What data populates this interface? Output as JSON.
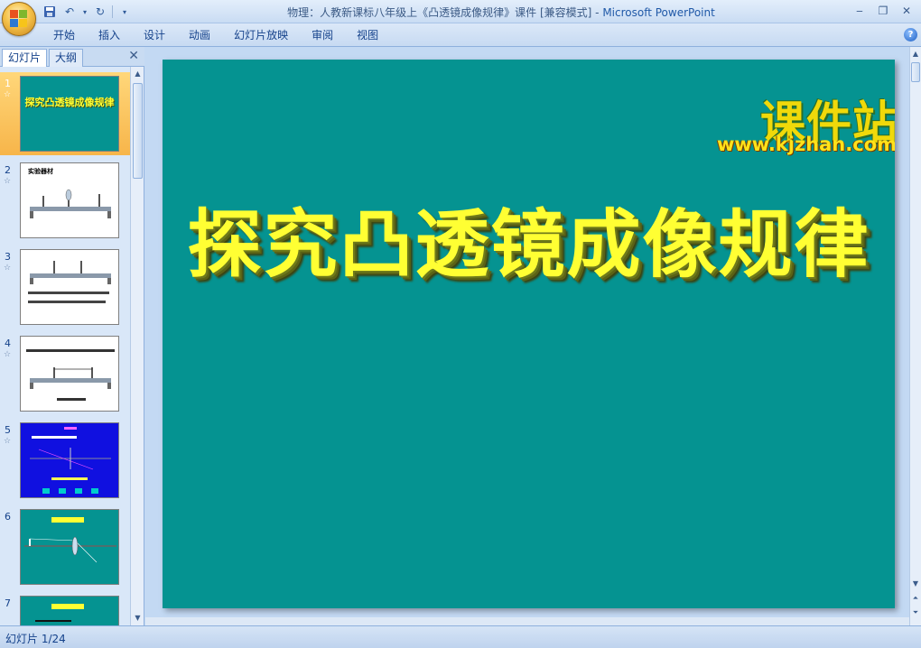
{
  "window": {
    "title": "物理：人教新课标八年级上《凸透镜成像规律》课件 [兼容模式] - ",
    "app_name": "Microsoft PowerPoint"
  },
  "ribbon": {
    "tabs": [
      "开始",
      "插入",
      "设计",
      "动画",
      "幻灯片放映",
      "审阅",
      "视图"
    ]
  },
  "left_pane": {
    "tabs": [
      "幻灯片",
      "大纲"
    ],
    "thumbnails": [
      {
        "num": "1",
        "title": "探究凸透镜成像规律",
        "bg": "#059391",
        "title_color": "#ffff33"
      },
      {
        "num": "2",
        "title": "实验器材",
        "bg": "#ffffff",
        "title_color": "#000000"
      },
      {
        "num": "3",
        "title": "",
        "bg": "#ffffff",
        "title_color": "#000000"
      },
      {
        "num": "4",
        "title": "",
        "bg": "#ffffff",
        "title_color": "#000000"
      },
      {
        "num": "5",
        "title": "",
        "bg": "#1010e0",
        "title_color": "#ff66ff"
      },
      {
        "num": "6",
        "title": "",
        "bg": "#059391",
        "title_color": "#ffff33"
      },
      {
        "num": "7",
        "title": "",
        "bg": "#059391",
        "title_color": "#ffff33"
      }
    ]
  },
  "slide": {
    "title": "探究凸透镜成像规律",
    "watermark_cn": "课件站",
    "watermark_url": "www.kjzhan.com",
    "bg": "#059391"
  },
  "status": {
    "slide_counter": "幻灯片 1/24"
  }
}
